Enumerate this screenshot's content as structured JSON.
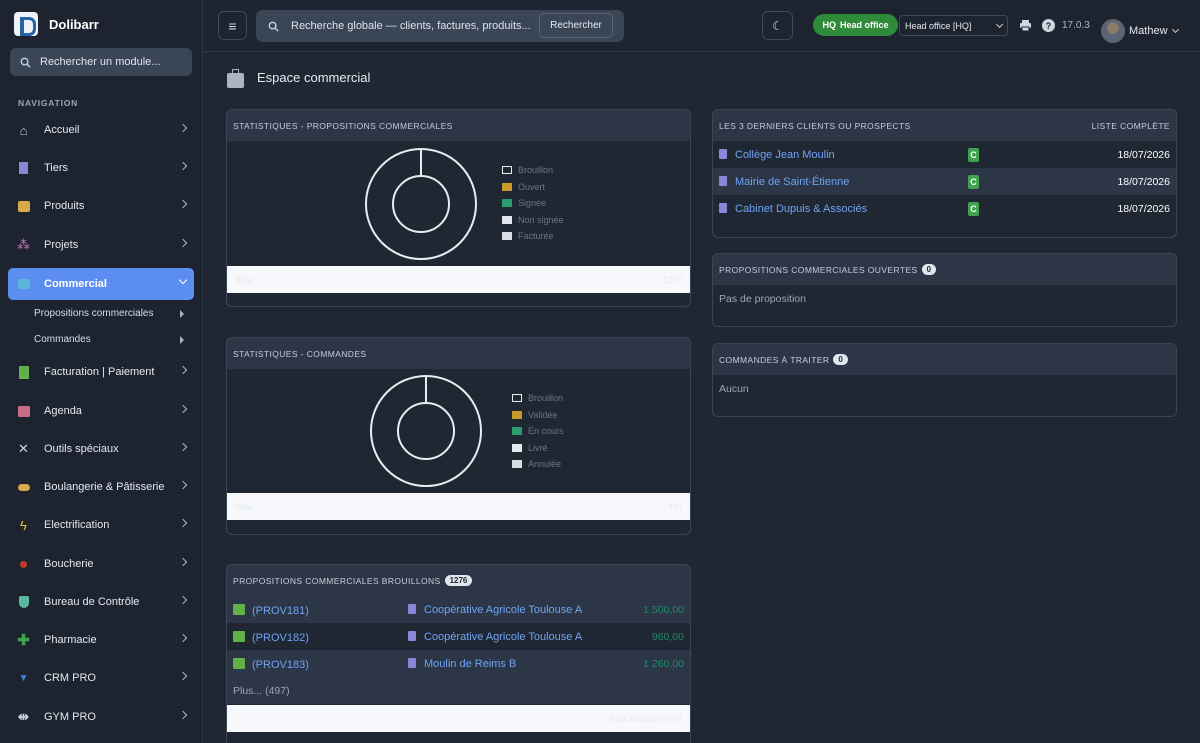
{
  "app": {
    "name": "Dolibarr",
    "version": "17.0.3"
  },
  "sidebar": {
    "search_placeholder": "Rechercher un module...",
    "nav_heading": "NAVIGATION",
    "items": [
      {
        "label": "Accueil",
        "icon": "home-icon",
        "color": "#c9d2de"
      },
      {
        "label": "Tiers",
        "icon": "building-icon",
        "color": "#8a86d8"
      },
      {
        "label": "Produits",
        "icon": "box-icon",
        "color": "#d8a84a"
      },
      {
        "label": "Projets",
        "icon": "sitemap-icon",
        "color": "#c77ab8"
      },
      {
        "label": "Commercial",
        "icon": "briefcase-icon",
        "color": "#5bb7d8"
      },
      {
        "label": "Facturation | Paiement",
        "icon": "invoice-icon",
        "color": "#61b048"
      },
      {
        "label": "Agenda",
        "icon": "calendar-icon",
        "color": "#c96b88"
      },
      {
        "label": "Outils spéciaux",
        "icon": "tools-icon",
        "color": "#c9d2de"
      },
      {
        "label": "Boulangerie & Pâtisserie",
        "icon": "bread-icon",
        "color": "#d8a84a"
      },
      {
        "label": "Electrification",
        "icon": "bolt-icon",
        "color": "#f2c230"
      },
      {
        "label": "Boucherie",
        "icon": "meat-icon",
        "color": "#c0392b"
      },
      {
        "label": "Bureau de Contrôle",
        "icon": "shield-icon",
        "color": "#5bb7a0"
      },
      {
        "label": "Pharmacie",
        "icon": "cross-icon",
        "color": "#3fa34d"
      },
      {
        "label": "CRM PRO",
        "icon": "funnel-icon",
        "color": "#3f7fe0"
      },
      {
        "label": "GYM PRO",
        "icon": "dumbbell-icon",
        "color": "#c9d2de"
      }
    ],
    "subitems": [
      "Propositions commerciales",
      "Commandes"
    ]
  },
  "topbar": {
    "search_placeholder": "Recherche globale — clients, factures, produits...",
    "search_button": "Rechercher",
    "hq_badge_code": "HQ",
    "hq_badge_label": "Head office",
    "entity_select": "Head office [HQ]",
    "user": "Mathew"
  },
  "page": {
    "title": "Espace commercial"
  },
  "stats_proposals": {
    "title": "STATISTIQUES - PROPOSITIONS COMMERCIALES",
    "legend": [
      {
        "label": "Brouillon",
        "color": "#1f2733"
      },
      {
        "label": "Ouvert",
        "color": "#c99a2a"
      },
      {
        "label": "Signée",
        "color": "#2a9d6e"
      },
      {
        "label": "Non signée",
        "color": "#e4e8ee"
      },
      {
        "label": "Facturée",
        "color": "#d8dde4"
      }
    ],
    "total_label": "Total",
    "total_value": "1276"
  },
  "stats_orders": {
    "title": "STATISTIQUES - COMMANDES",
    "legend": [
      {
        "label": "Brouillon",
        "color": "#1f2733"
      },
      {
        "label": "Validée",
        "color": "#c99a2a"
      },
      {
        "label": "En cours",
        "color": "#2a9d6e"
      },
      {
        "label": "Livré",
        "color": "#e4e8ee"
      },
      {
        "label": "Annulée",
        "color": "#d8dde4"
      }
    ],
    "total_label": "Total",
    "total_value": "497"
  },
  "draft_proposals": {
    "title": "PROPOSITIONS COMMERCIALES BROUILLONS",
    "count": "1276",
    "rows": [
      {
        "ref": "(PROV181)",
        "client": "Coopérative Agricole Toulouse A",
        "amount": "1 500,00"
      },
      {
        "ref": "(PROV182)",
        "client": "Coopérative Agricole Toulouse A",
        "amount": "960,00"
      },
      {
        "ref": "(PROV183)",
        "client": "Moulin de Reims B",
        "amount": "1 260,00"
      }
    ],
    "more": "Plus... (497)",
    "footer": "Total brouillons HT"
  },
  "last_clients": {
    "title": "LES 3 DERNIERS CLIENTS OU PROSPECTS",
    "link": "LISTE COMPLÈTE",
    "rows": [
      {
        "name": "Collège Jean Moulin",
        "badge": "C",
        "date": "18/07/2026"
      },
      {
        "name": "Mairie de Saint-Étienne",
        "badge": "C",
        "date": "18/07/2026"
      },
      {
        "name": "Cabinet Dupuis & Associés",
        "badge": "C",
        "date": "18/07/2026"
      }
    ]
  },
  "open_proposals": {
    "title": "PROPOSITIONS COMMERCIALES OUVERTES",
    "count": "0",
    "empty": "Pas de proposition"
  },
  "orders_todo": {
    "title": "COMMANDES À TRAITER",
    "count": "0",
    "empty": "Aucun"
  }
}
